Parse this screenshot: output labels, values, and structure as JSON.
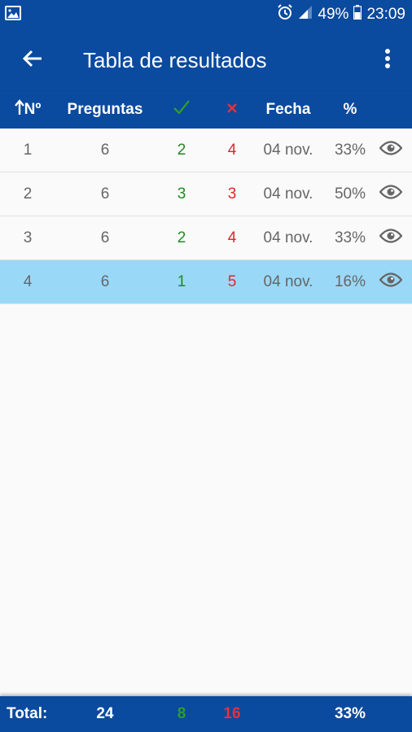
{
  "status_bar": {
    "battery": "49%",
    "time": "23:09"
  },
  "app_bar": {
    "title": "Tabla de resultados"
  },
  "table": {
    "headers": {
      "number": "Nº",
      "questions": "Preguntas",
      "date": "Fecha",
      "percent": "%"
    },
    "rows": [
      {
        "num": "1",
        "questions": "6",
        "correct": "2",
        "wrong": "4",
        "date": "04 nov.",
        "percent": "33%"
      },
      {
        "num": "2",
        "questions": "6",
        "correct": "3",
        "wrong": "3",
        "date": "04 nov.",
        "percent": "50%"
      },
      {
        "num": "3",
        "questions": "6",
        "correct": "2",
        "wrong": "4",
        "date": "04 nov.",
        "percent": "33%"
      },
      {
        "num": "4",
        "questions": "6",
        "correct": "1",
        "wrong": "5",
        "date": "04 nov.",
        "percent": "16%"
      }
    ],
    "selected_row": 3
  },
  "footer": {
    "label": "Total:",
    "questions": "24",
    "correct": "8",
    "wrong": "16",
    "percent": "33%"
  },
  "colors": {
    "primary": "#0a4a9f",
    "correct": "#1e8c1e",
    "wrong": "#e0262c",
    "selected_row": "#9ad8f8"
  },
  "icons": {
    "image_notification": "image-icon",
    "alarm": "alarm-icon",
    "signal": "signal-icon",
    "battery": "battery-icon",
    "back": "arrow-left-icon",
    "menu": "more-vert-icon",
    "sort": "arrow-up-icon",
    "correct": "check-icon",
    "wrong": "cross-icon",
    "view": "eye-icon"
  }
}
